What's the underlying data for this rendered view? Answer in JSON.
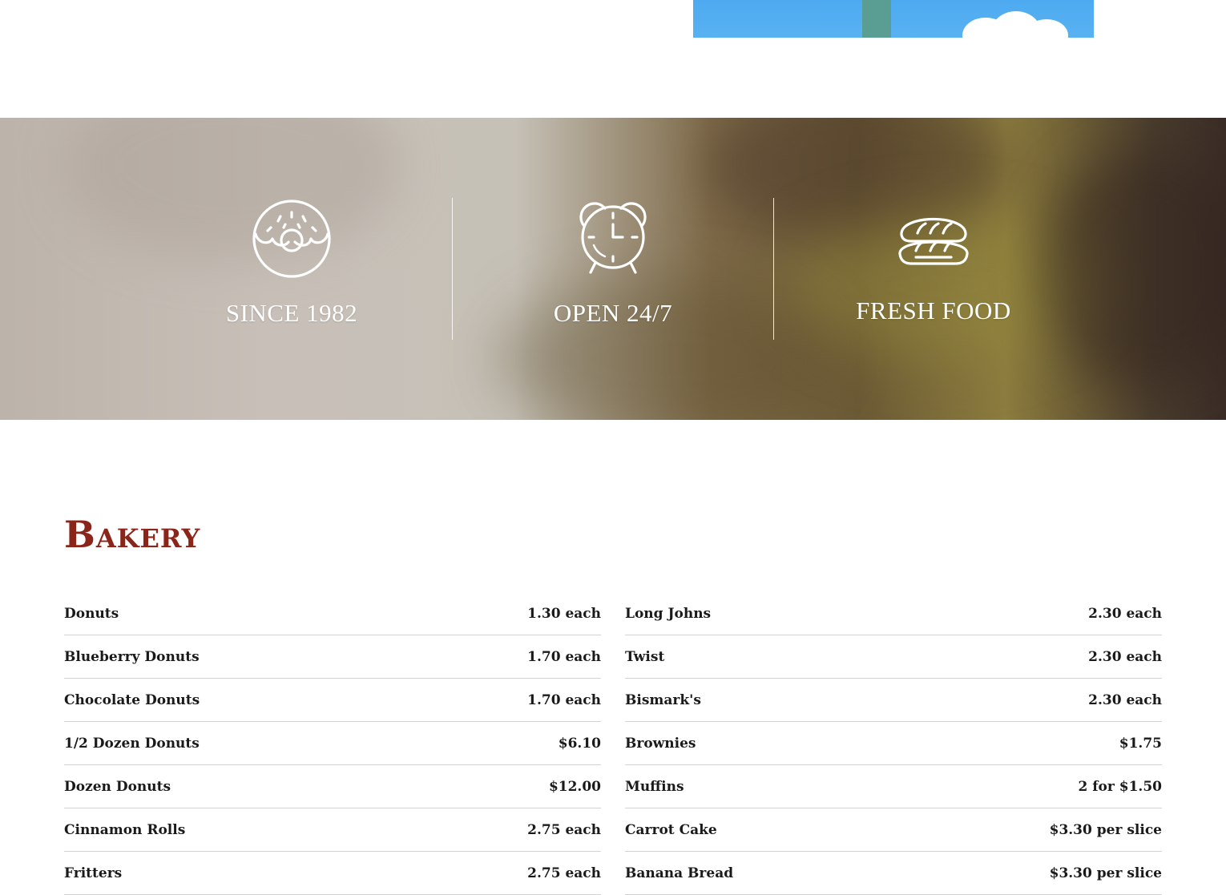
{
  "features": [
    {
      "icon": "donut-icon",
      "label": "SINCE 1982"
    },
    {
      "icon": "alarm-clock-icon",
      "label": "OPEN 24/7"
    },
    {
      "icon": "bread-icon",
      "label": "FRESH FOOD"
    }
  ],
  "bakery": {
    "title": "Bakery",
    "left_items": [
      {
        "name": "Donuts",
        "price": "1.30 each"
      },
      {
        "name": "Blueberry Donuts",
        "price": "1.70 each"
      },
      {
        "name": "Chocolate Donuts",
        "price": "1.70 each"
      },
      {
        "name": "1/2 Dozen Donuts",
        "price": "$6.10"
      },
      {
        "name": "Dozen Donuts",
        "price": "$12.00"
      },
      {
        "name": "Cinnamon Rolls",
        "price": "2.75 each"
      },
      {
        "name": "Fritters",
        "price": "2.75 each"
      }
    ],
    "right_items": [
      {
        "name": "Long Johns",
        "price": "2.30 each"
      },
      {
        "name": "Twist",
        "price": "2.30 each"
      },
      {
        "name": "Bismark's",
        "price": "2.30 each"
      },
      {
        "name": "Brownies",
        "price": "$1.75"
      },
      {
        "name": "Muffins",
        "price": "2 for $1.50"
      },
      {
        "name": "Carrot Cake",
        "price": "$3.30 per slice"
      },
      {
        "name": "Banana Bread",
        "price": "$3.30 per slice"
      }
    ]
  },
  "colors": {
    "title": "#8b2419",
    "divider": "#d3d3d3",
    "sky": "#4eaaf0"
  }
}
